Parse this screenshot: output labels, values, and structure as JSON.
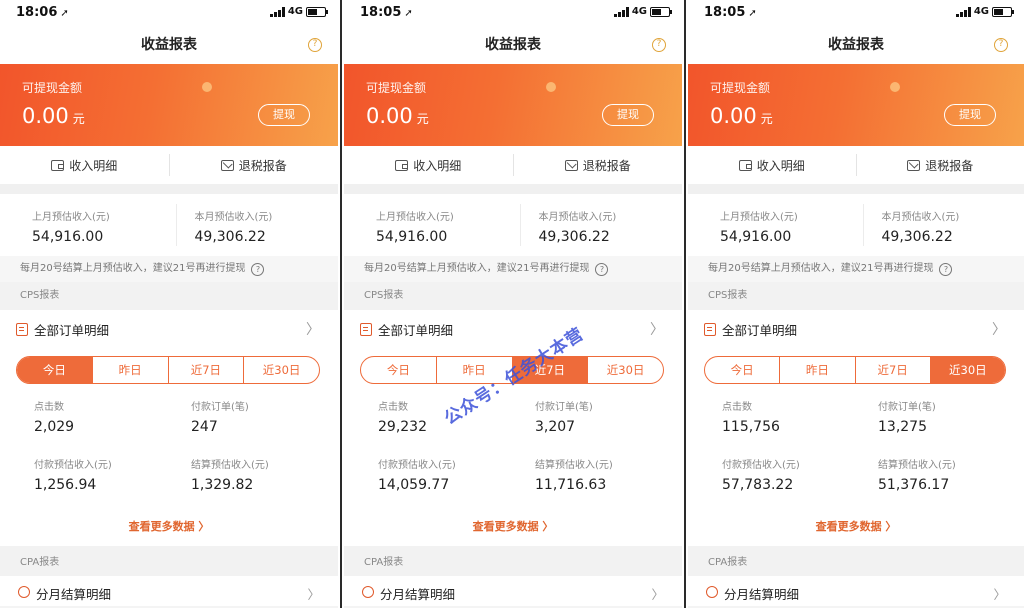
{
  "screens": [
    {
      "status": {
        "time": "18:06",
        "network": "4G"
      },
      "nav": {
        "title": "收益报表",
        "help": "?"
      },
      "banner": {
        "label": "可提现金额",
        "amount": "0.00",
        "unit": "元",
        "withdraw": "提现"
      },
      "quick": {
        "income_detail": "收入明细",
        "tax_report": "退税报备"
      },
      "income": {
        "last_month_label": "上月预估收入(元)",
        "last_month_value": "54,916.00",
        "this_month_label": "本月预估收入(元)",
        "this_month_value": "49,306.22"
      },
      "note": "每月20号结算上月预估收入，建议21号再进行提现",
      "cps_section": "CPS报表",
      "order_row": "全部订单明细",
      "tabs": [
        "今日",
        "昨日",
        "近7日",
        "近30日"
      ],
      "active_tab": "今日",
      "stats": {
        "clicks_label": "点击数",
        "clicks": "2,029",
        "orders_label": "付款订单(笔)",
        "orders": "247",
        "pay_income_label": "付款预估收入(元)",
        "pay_income": "1,256.94",
        "settle_income_label": "结算预估收入(元)",
        "settle_income": "1,329.82"
      },
      "more": "查看更多数据 〉",
      "cpa_section": "CPA报表",
      "cpa_row": "分月结算明细"
    },
    {
      "status": {
        "time": "18:05",
        "network": "4G"
      },
      "nav": {
        "title": "收益报表",
        "help": "?"
      },
      "banner": {
        "label": "可提现金额",
        "amount": "0.00",
        "unit": "元",
        "withdraw": "提现"
      },
      "quick": {
        "income_detail": "收入明细",
        "tax_report": "退税报备"
      },
      "income": {
        "last_month_label": "上月预估收入(元)",
        "last_month_value": "54,916.00",
        "this_month_label": "本月预估收入(元)",
        "this_month_value": "49,306.22"
      },
      "note": "每月20号结算上月预估收入，建议21号再进行提现",
      "cps_section": "CPS报表",
      "order_row": "全部订单明细",
      "tabs": [
        "今日",
        "昨日",
        "近7日",
        "近30日"
      ],
      "active_tab": "近7日",
      "stats": {
        "clicks_label": "点击数",
        "clicks": "29,232",
        "orders_label": "付款订单(笔)",
        "orders": "3,207",
        "pay_income_label": "付款预估收入(元)",
        "pay_income": "14,059.77",
        "settle_income_label": "结算预估收入(元)",
        "settle_income": "11,716.63"
      },
      "more": "查看更多数据 〉",
      "cpa_section": "CPA报表",
      "cpa_row": "分月结算明细"
    },
    {
      "status": {
        "time": "18:05",
        "network": "4G"
      },
      "nav": {
        "title": "收益报表",
        "help": "?"
      },
      "banner": {
        "label": "可提现金额",
        "amount": "0.00",
        "unit": "元",
        "withdraw": "提现"
      },
      "quick": {
        "income_detail": "收入明细",
        "tax_report": "退税报备"
      },
      "income": {
        "last_month_label": "上月预估收入(元)",
        "last_month_value": "54,916.00",
        "this_month_label": "本月预估收入(元)",
        "this_month_value": "49,306.22"
      },
      "note": "每月20号结算上月预估收入，建议21号再进行提现",
      "cps_section": "CPS报表",
      "order_row": "全部订单明细",
      "tabs": [
        "今日",
        "昨日",
        "近7日",
        "近30日"
      ],
      "active_tab": "近30日",
      "stats": {
        "clicks_label": "点击数",
        "clicks": "115,756",
        "orders_label": "付款订单(笔)",
        "orders": "13,275",
        "pay_income_label": "付款预估收入(元)",
        "pay_income": "57,783.22",
        "settle_income_label": "结算预估收入(元)",
        "settle_income": "51,376.17"
      },
      "more": "查看更多数据 〉",
      "cpa_section": "CPA报表",
      "cpa_row": "分月结算明细"
    }
  ],
  "watermark": "公众号：任务大本营",
  "colors": {
    "accent": "#ee6b3a",
    "banner_start": "#f2552b",
    "banner_end": "#f7a24a",
    "link": "#e0662f"
  }
}
